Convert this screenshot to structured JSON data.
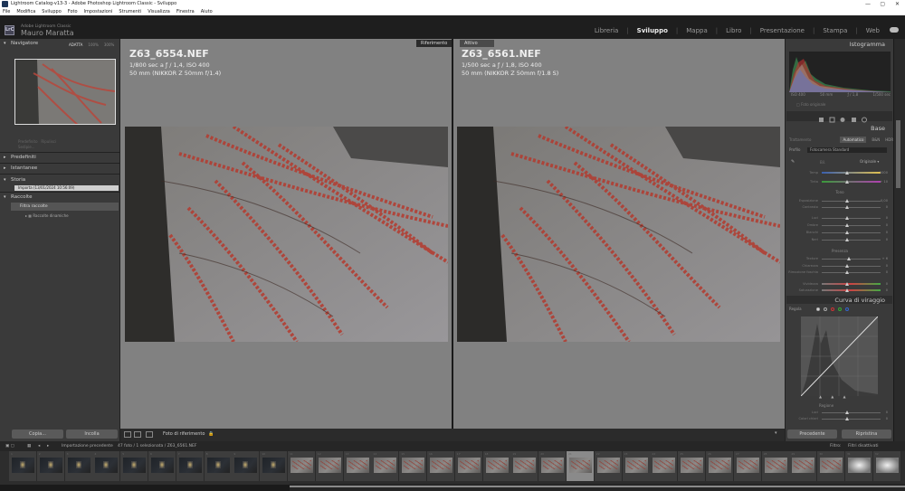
{
  "window": {
    "title": "Lightroom Catalog-v13-3 - Adobe Photoshop Lightroom Classic - Sviluppo"
  },
  "menu": [
    "File",
    "Modifica",
    "Sviluppo",
    "Foto",
    "Impostazioni",
    "Strumenti",
    "Visualizza",
    "Finestra",
    "Aiuto"
  ],
  "identity": {
    "app": "Adobe Lightroom Classic",
    "user": "Mauro Maratta"
  },
  "modules": {
    "items": [
      "Libreria",
      "Sviluppo",
      "Mappa",
      "Libro",
      "Presentazione",
      "Stampa",
      "Web"
    ],
    "active": "Sviluppo"
  },
  "navigator": {
    "title": "Navigatore",
    "zoom_options": [
      "ADATTA",
      "100%",
      "300%"
    ]
  },
  "left_ghost": {
    "a": "Predefinito",
    "b": "Ripulisci",
    "c": "Sedipie..."
  },
  "left_panels": {
    "predefiniti": "Predefiniti",
    "istantanee": "Istantanee",
    "storia": "Storia",
    "storia_item": "Importa (13/01/2024 10:56:09)",
    "raccolte": "Raccolte",
    "filtro": "Filtra raccolte",
    "dinamiche": "Raccolte dinamiche"
  },
  "left_buttons": {
    "copy": "Copia...",
    "paste": "Incolla"
  },
  "compare": {
    "ref_tag": "Riferimento",
    "active_tag": "Attivo"
  },
  "ref_photo": {
    "name": "Z63_6554.NEF",
    "exposure": "1/800 sec a ƒ / 1,4, ISO 400",
    "lens": "50 mm (NIKKOR Z 50mm f/1.4)"
  },
  "active_photo": {
    "name": "Z63_6561.NEF",
    "exposure": "1/500 sec a ƒ / 1,8, ISO 400",
    "lens": "50 mm (NIKKOR Z 50mm f/1.8 S)"
  },
  "toolbar": {
    "ref_label": "Foto di riferimento"
  },
  "right": {
    "histogram_title": "Istogramma",
    "hist_info": [
      "ISO 400",
      "50 mm",
      "ƒ / 1,8",
      "1/500 sec"
    ],
    "original_photo": "Foto originale",
    "base_title": "Base",
    "treatment_label": "Trattamento",
    "treatment_opts": [
      "Automatico",
      "B&N",
      "HDR"
    ],
    "profile_label": "Profilo",
    "profile_value": "Fotocamera Standard",
    "original_label": "Originale",
    "wb_label": "Bil.",
    "sliders": [
      {
        "label": "Temp",
        "value": "5000"
      },
      {
        "label": "Tinta",
        "value": "+ 10"
      },
      {
        "label": "Esposizione",
        "value": "0,00"
      },
      {
        "label": "Contrasto",
        "value": "0"
      },
      {
        "label": "Luci",
        "value": "0"
      },
      {
        "label": "Ombre",
        "value": "0"
      },
      {
        "label": "Bianchi",
        "value": "0"
      },
      {
        "label": "Neri",
        "value": "0"
      },
      {
        "label": "Texture",
        "value": "+ 6"
      },
      {
        "label": "Chiarezza",
        "value": "0"
      },
      {
        "label": "Rimozione foschia",
        "value": "0"
      },
      {
        "label": "Vividezza",
        "value": "0"
      },
      {
        "label": "Saturazione",
        "value": "0"
      }
    ],
    "group_tone": "Tono",
    "group_presence": "Presenza",
    "curve_title": "Curva di viraggio",
    "curve_label": "Regola",
    "region_label": "Regione",
    "region_sliders": [
      "Luci",
      "Colori chiari"
    ],
    "prev_button": "Precedente",
    "reset_button": "Ripristina"
  },
  "filmbar": {
    "source": "Importazione precedente",
    "count": "47 foto / 1 selezionata / Z63_6561.NEF",
    "filter_label": "Filtro:",
    "filter_value": "Filtri disattivati"
  },
  "filmstrip": {
    "numbers": [
      "1",
      "2",
      "3",
      "4",
      "5",
      "6",
      "7",
      "8",
      "9",
      "10",
      "11",
      "12",
      "13",
      "14",
      "15",
      "16",
      "17",
      "18",
      "19",
      "20",
      "21",
      "22",
      "23",
      "24",
      "25",
      "26",
      "27",
      "28",
      "29",
      "30",
      "31",
      "32"
    ],
    "kinds": [
      "dark",
      "dark",
      "dark",
      "dark",
      "dark",
      "dark",
      "dark",
      "dark",
      "dark",
      "dark",
      "light",
      "light",
      "light",
      "light",
      "light",
      "light",
      "light",
      "light",
      "light",
      "light",
      "light",
      "light",
      "light",
      "light",
      "light",
      "light",
      "light",
      "light",
      "light",
      "light",
      "white",
      "white"
    ],
    "selected": 20
  }
}
